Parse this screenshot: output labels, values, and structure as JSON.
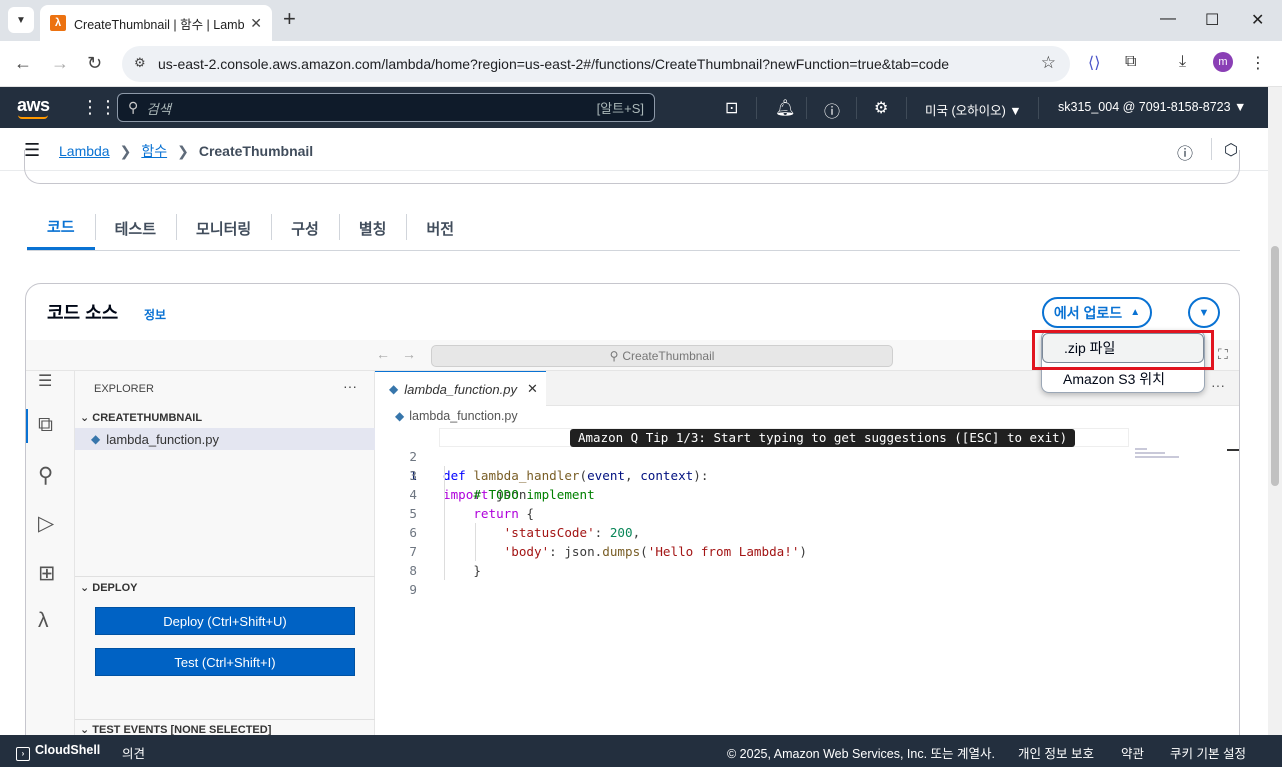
{
  "browser": {
    "tab_title": "CreateThumbnail | 함수 | Lambda",
    "url": "us-east-2.console.aws.amazon.com/lambda/home?region=us-east-2#/functions/CreateThumbnail?newFunction=true&tab=code",
    "profile_initial": "m"
  },
  "aws_nav": {
    "logo": "aws",
    "search_placeholder": "검색",
    "search_shortcut": "[알트+S]",
    "region": "미국 (오하이오) ▼",
    "account": "sk315_004 @ 7091-8158-8723 ▼"
  },
  "breadcrumb": {
    "items": [
      "Lambda",
      "함수"
    ],
    "current": "CreateThumbnail"
  },
  "tabs": [
    {
      "label": "코드",
      "active": true
    },
    {
      "label": "테스트",
      "active": false
    },
    {
      "label": "모니터링",
      "active": false
    },
    {
      "label": "구성",
      "active": false
    },
    {
      "label": "별칭",
      "active": false
    },
    {
      "label": "버전",
      "active": false
    }
  ],
  "code_source": {
    "title": "코드 소스",
    "info": "정보",
    "upload_label": "에서 업로드",
    "upload_menu": [
      ".zip 파일",
      "Amazon S3 위치"
    ]
  },
  "ide": {
    "search_text": "CreateThumbnail",
    "explorer_title": "EXPLORER",
    "folder": "CREATETHUMBNAIL",
    "file": "lambda_function.py",
    "deploy_section": "DEPLOY",
    "deploy_button": "Deploy (Ctrl+Shift+U)",
    "test_button": "Test (Ctrl+Shift+I)",
    "test_events": "TEST EVENTS [NONE SELECTED]",
    "editor_tab": "lambda_function.py",
    "editor_breadcrumb": "lambda_function.py",
    "tip": "Amazon Q Tip 1/3: Start typing to get suggestions ([ESC] to exit)",
    "line_numbers": [
      "1",
      "2",
      "3",
      "4",
      "5",
      "6",
      "7",
      "8",
      "9"
    ]
  },
  "footer": {
    "cloudshell": "CloudShell",
    "feedback": "의견",
    "copyright": "© 2025, Amazon Web Services, Inc. 또는 계열사.",
    "privacy": "개인 정보 보호",
    "terms": "약관",
    "cookies": "쿠키 기본 설정"
  }
}
